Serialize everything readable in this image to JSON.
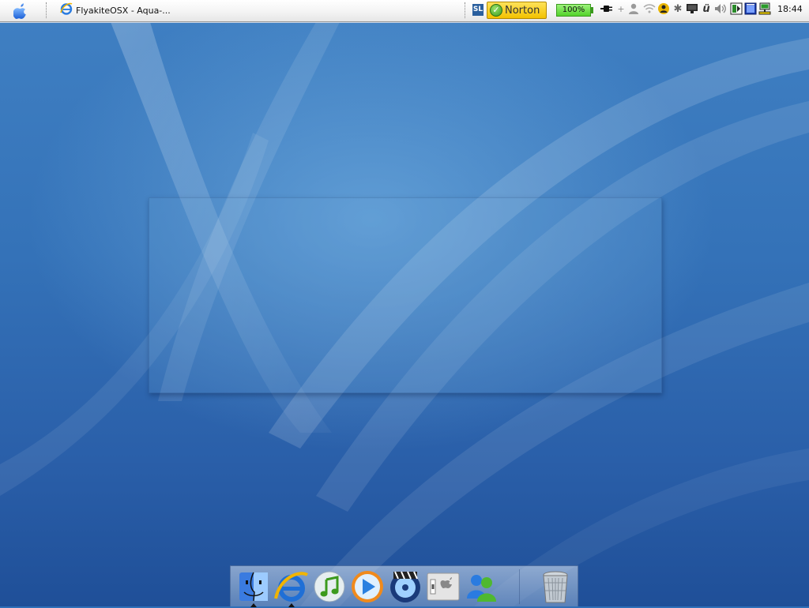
{
  "menubar": {
    "apple_icon": "apple-icon",
    "task": {
      "icon": "internet-explorer-icon",
      "label": "FlyakiteOSX - Aqua-..."
    },
    "tray": {
      "sl_label": "SL",
      "norton_label": "Norton",
      "battery_percent": "100%",
      "icons": [
        "power-plug-icon",
        "user-icon",
        "wifi-icon",
        "messenger-icon",
        "bluetooth-icon",
        "display-icon",
        "font-u-icon",
        "volume-icon",
        "app-tray-icon",
        "window-icon",
        "network-icon"
      ]
    },
    "clock": "18:44"
  },
  "dock": {
    "items": [
      {
        "name": "finder-icon",
        "running": true
      },
      {
        "name": "internet-explorer-icon",
        "running": true
      },
      {
        "name": "itunes-icon",
        "running": false
      },
      {
        "name": "media-player-icon",
        "running": false
      },
      {
        "name": "dvd-player-icon",
        "running": false
      },
      {
        "name": "system-preferences-icon",
        "running": false
      },
      {
        "name": "msn-messenger-icon",
        "running": false
      },
      {
        "name": "trash-icon",
        "running": false
      }
    ]
  },
  "colors": {
    "menubar_top": "#ffffff",
    "wallpaper_blue": "#3472b8",
    "norton_yellow": "#f2c200",
    "battery_green": "#53d22c"
  }
}
